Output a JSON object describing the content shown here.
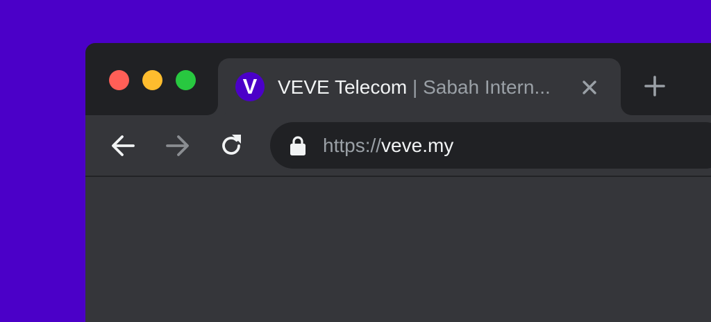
{
  "colors": {
    "background": "#4b00c8",
    "window_frame": "#202124",
    "tab_active": "#35363a",
    "toolbar": "#35363a",
    "omnibox": "#202124",
    "text_primary": "#f1f3f4",
    "text_secondary": "#9aa0a6",
    "close_button": "#ff5f57",
    "minimize_button": "#febc2e",
    "zoom_button": "#28c840",
    "favicon_bg": "#4b00c8"
  },
  "window_controls": [
    {
      "name": "close",
      "color": "#ff5f57"
    },
    {
      "name": "minimize",
      "color": "#febc2e"
    },
    {
      "name": "zoom",
      "color": "#28c840"
    }
  ],
  "tab": {
    "favicon_letter": "V",
    "title_main": "VEVE Telecom",
    "title_separator": " | ",
    "title_rest": "Sabah Intern...",
    "close_icon": "close-icon"
  },
  "new_tab_icon": "plus-icon",
  "toolbar": {
    "back_icon": "arrow-left-icon",
    "forward_icon": "arrow-right-icon",
    "forward_disabled": true,
    "reload_icon": "reload-icon"
  },
  "address_bar": {
    "lock_icon": "lock-icon",
    "scheme": "https://",
    "host": "veve.my"
  }
}
